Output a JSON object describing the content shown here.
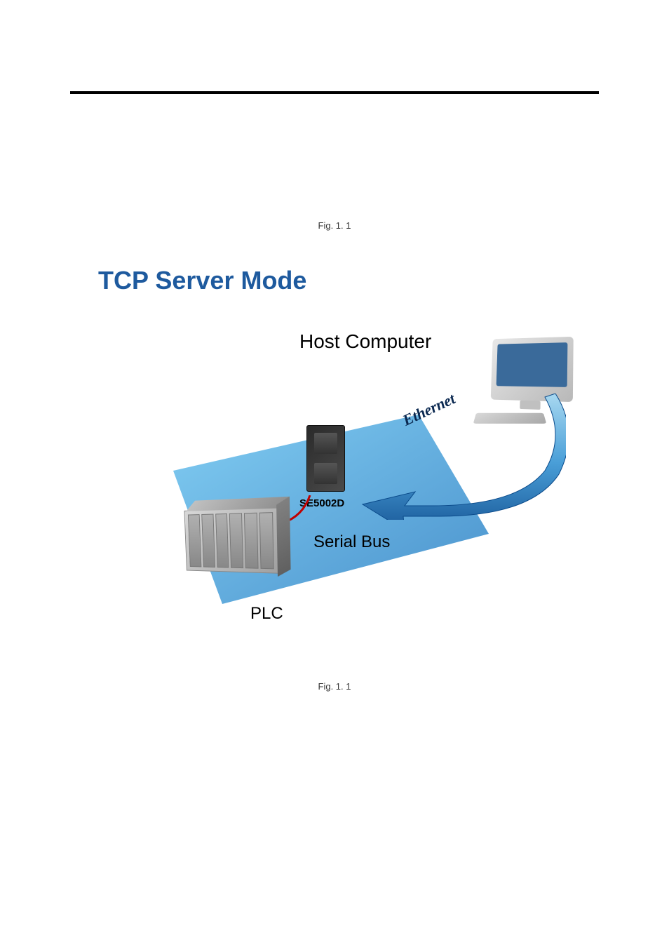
{
  "captions": {
    "top": "Fig. 1. 1",
    "bottom": "Fig. 1. 1"
  },
  "title": "TCP Server Mode",
  "labels": {
    "host": "Host Computer",
    "device": "SE5002D",
    "serial": "Serial Bus",
    "plc": "PLC",
    "ethernet": "Ethernet"
  },
  "colors": {
    "title": "#1e5a9e",
    "platform": "#3a9dd8",
    "arrow": "#2a7fc4",
    "serial_line": "#c00000"
  }
}
